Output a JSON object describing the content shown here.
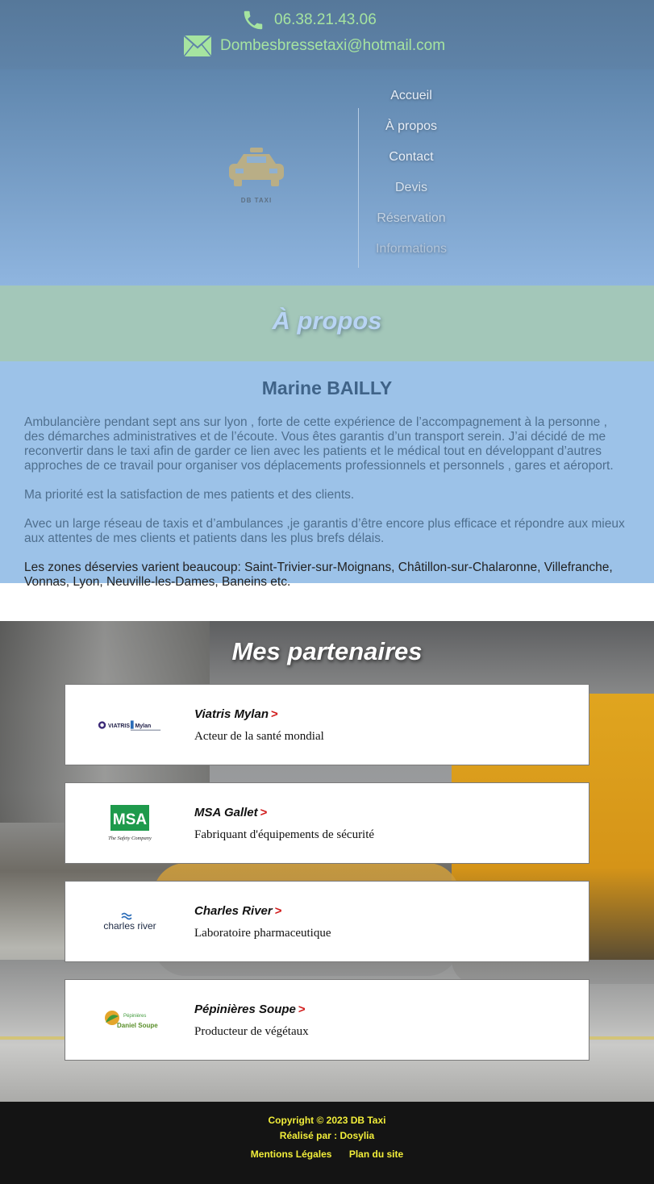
{
  "contact": {
    "phone": "06.38.21.43.06",
    "email": "Dombesbressetaxi@hotmail.com",
    "phone_icon": "phone-icon",
    "email_icon": "envelope-icon",
    "accent_color": "#a6e4a0"
  },
  "logo": {
    "text": "DB TAXI",
    "icon": "taxi-icon"
  },
  "nav": {
    "items": [
      {
        "label": "Accueil"
      },
      {
        "label": "À propos"
      },
      {
        "label": "Contact"
      },
      {
        "label": "Devis"
      },
      {
        "label": "Réservation"
      },
      {
        "label": "Informations"
      }
    ]
  },
  "page": {
    "title": "À propos"
  },
  "about": {
    "name": "Marine BAILLY",
    "paragraphs": [
      "Ambulancière pendant sept ans sur lyon , forte de cette expérience de l’accompagnement à la personne , des démarches administratives et de l’écoute. Vous êtes garantis d’un transport serein. J’ai décidé de me reconvertir dans le taxi afin de garder ce lien avec les patients et le médical tout en développant d’autres approches de ce travail pour organiser vos déplacements professionnels et personnels , gares et aéroport.",
      "Ma priorité est la satisfaction de mes patients et des clients.",
      "Avec un large réseau de taxis et d’ambulances ,je garantis d’être encore plus efficace et répondre aux mieux aux attentes de mes clients et patients dans les plus brefs délais.",
      "Les zones déservies varient beaucoup: Saint-Trivier-sur-Moignans, Châtillon-sur-Chalaronne, Villefranche, Vonnas, Lyon, Neuville-les-Dames, Baneins etc."
    ]
  },
  "partners": {
    "title": "Mes partenaires",
    "items": [
      {
        "name": "Viatris Mylan",
        "arrow": ">",
        "description": "Acteur de la santé mondial",
        "logo_text": "VIATRIS",
        "logo_text2": "Mylan"
      },
      {
        "name": "MSA Gallet",
        "arrow": ">",
        "description": "Fabriquant d'équipements de sécurité",
        "logo_text": "MSA",
        "logo_text2": "The Safety Company"
      },
      {
        "name": "Charles River",
        "arrow": ">",
        "description": "Laboratoire pharmaceutique",
        "logo_text": "charles river"
      },
      {
        "name": "Pépinières Soupe",
        "arrow": ">",
        "description": "Producteur de végétaux",
        "logo_text": "Pépinières",
        "logo_text2": "Daniel Soupe"
      }
    ]
  },
  "footer": {
    "copyright": "Copyright © 2023 DB Taxi",
    "credit": "Réalisé par : Dosylia",
    "links": [
      {
        "label": "Mentions Légales"
      },
      {
        "label": "Plan du site"
      }
    ],
    "text_color": "#f2ee3a"
  }
}
